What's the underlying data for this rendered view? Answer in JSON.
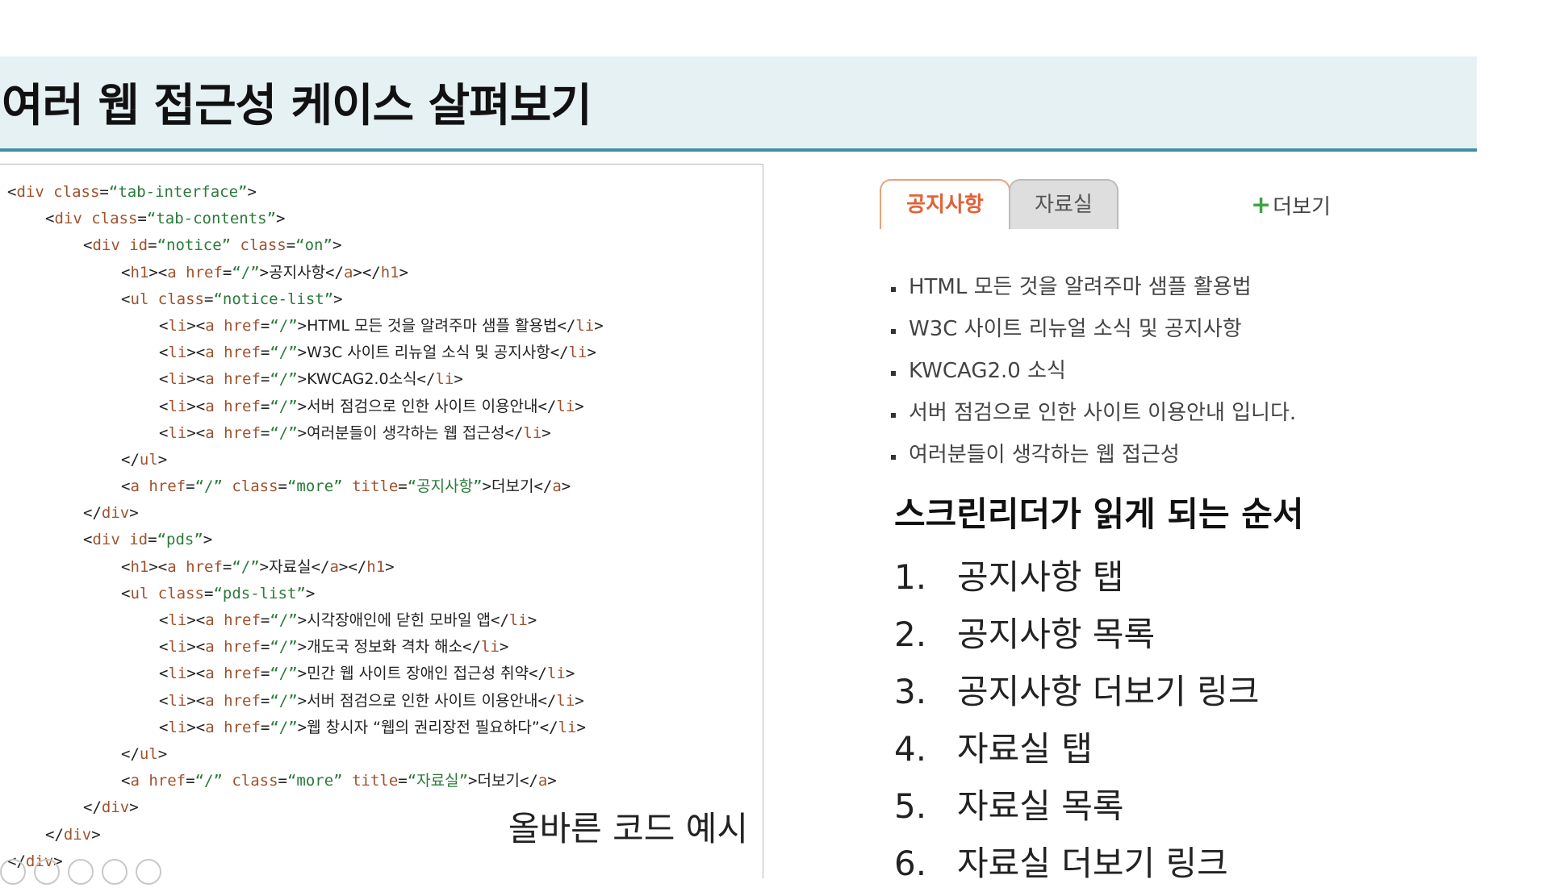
{
  "slide": {
    "title": "여러 웹 접근성 케이스 살펴보기",
    "caption": "올바른 코드 예시"
  },
  "code_lines": [
    {
      "indent": 0,
      "parts": [
        [
          "p",
          "<"
        ],
        [
          "t",
          "div"
        ],
        [
          "a",
          " class"
        ],
        [
          "p",
          "="
        ],
        [
          "v",
          "“tab-interface”"
        ],
        [
          "p",
          ">"
        ]
      ]
    },
    {
      "indent": 1,
      "parts": [
        [
          "p",
          "<"
        ],
        [
          "t",
          "div"
        ],
        [
          "a",
          " class"
        ],
        [
          "p",
          "="
        ],
        [
          "v",
          "“tab-contents”"
        ],
        [
          "p",
          ">"
        ]
      ]
    },
    {
      "indent": 2,
      "parts": [
        [
          "p",
          "<"
        ],
        [
          "t",
          "div"
        ],
        [
          "a",
          " id"
        ],
        [
          "p",
          "="
        ],
        [
          "v",
          "“notice”"
        ],
        [
          "a",
          " class"
        ],
        [
          "p",
          "="
        ],
        [
          "v",
          "“on”"
        ],
        [
          "p",
          ">"
        ]
      ]
    },
    {
      "indent": 3,
      "parts": [
        [
          "p",
          "<"
        ],
        [
          "t",
          "h1"
        ],
        [
          "p",
          "><"
        ],
        [
          "t",
          "a"
        ],
        [
          "a",
          " href"
        ],
        [
          "p",
          "="
        ],
        [
          "v",
          "“/”"
        ],
        [
          "p",
          ">"
        ],
        [
          "x",
          "공지사항"
        ],
        [
          "p",
          "</"
        ],
        [
          "t",
          "a"
        ],
        [
          "p",
          "></"
        ],
        [
          "t",
          "h1"
        ],
        [
          "p",
          ">"
        ]
      ]
    },
    {
      "indent": 3,
      "parts": [
        [
          "p",
          "<"
        ],
        [
          "t",
          "ul"
        ],
        [
          "a",
          " class"
        ],
        [
          "p",
          "="
        ],
        [
          "v",
          "“notice-list”"
        ],
        [
          "p",
          ">"
        ]
      ]
    },
    {
      "indent": 4,
      "parts": [
        [
          "p",
          "<"
        ],
        [
          "t",
          "li"
        ],
        [
          "p",
          "><"
        ],
        [
          "t",
          "a"
        ],
        [
          "a",
          " href"
        ],
        [
          "p",
          "="
        ],
        [
          "v",
          "“/”"
        ],
        [
          "p",
          ">"
        ],
        [
          "x",
          "HTML 모든 것을 알려주마 샘플 활용법"
        ],
        [
          "p",
          "</"
        ],
        [
          "t",
          "li"
        ],
        [
          "p",
          ">"
        ]
      ]
    },
    {
      "indent": 4,
      "parts": [
        [
          "p",
          "<"
        ],
        [
          "t",
          "li"
        ],
        [
          "p",
          "><"
        ],
        [
          "t",
          "a"
        ],
        [
          "a",
          " href"
        ],
        [
          "p",
          "="
        ],
        [
          "v",
          "“/”"
        ],
        [
          "p",
          ">"
        ],
        [
          "x",
          "W3C 사이트 리뉴얼 소식 및 공지사항"
        ],
        [
          "p",
          "</"
        ],
        [
          "t",
          "li"
        ],
        [
          "p",
          ">"
        ]
      ]
    },
    {
      "indent": 4,
      "parts": [
        [
          "p",
          "<"
        ],
        [
          "t",
          "li"
        ],
        [
          "p",
          "><"
        ],
        [
          "t",
          "a"
        ],
        [
          "a",
          " href"
        ],
        [
          "p",
          "="
        ],
        [
          "v",
          "“/”"
        ],
        [
          "p",
          ">"
        ],
        [
          "x",
          "KWCAG2.0소식"
        ],
        [
          "p",
          "</"
        ],
        [
          "t",
          "li"
        ],
        [
          "p",
          ">"
        ]
      ]
    },
    {
      "indent": 4,
      "parts": [
        [
          "p",
          "<"
        ],
        [
          "t",
          "li"
        ],
        [
          "p",
          "><"
        ],
        [
          "t",
          "a"
        ],
        [
          "a",
          " href"
        ],
        [
          "p",
          "="
        ],
        [
          "v",
          "“/”"
        ],
        [
          "p",
          ">"
        ],
        [
          "x",
          "서버 점검으로 인한 사이트 이용안내"
        ],
        [
          "p",
          "</"
        ],
        [
          "t",
          "li"
        ],
        [
          "p",
          ">"
        ]
      ]
    },
    {
      "indent": 4,
      "parts": [
        [
          "p",
          "<"
        ],
        [
          "t",
          "li"
        ],
        [
          "p",
          "><"
        ],
        [
          "t",
          "a"
        ],
        [
          "a",
          " href"
        ],
        [
          "p",
          "="
        ],
        [
          "v",
          "“/”"
        ],
        [
          "p",
          ">"
        ],
        [
          "x",
          "여러분들이 생각하는 웹 접근성"
        ],
        [
          "p",
          "</"
        ],
        [
          "t",
          "li"
        ],
        [
          "p",
          ">"
        ]
      ]
    },
    {
      "indent": 3,
      "parts": [
        [
          "p",
          "</"
        ],
        [
          "t",
          "ul"
        ],
        [
          "p",
          ">"
        ]
      ]
    },
    {
      "indent": 3,
      "parts": [
        [
          "p",
          "<"
        ],
        [
          "t",
          "a"
        ],
        [
          "a",
          " href"
        ],
        [
          "p",
          "="
        ],
        [
          "v",
          "“/”"
        ],
        [
          "a",
          " class"
        ],
        [
          "p",
          "="
        ],
        [
          "v",
          "“more”"
        ],
        [
          "a",
          " title"
        ],
        [
          "p",
          "="
        ],
        [
          "v",
          "“공지사항”"
        ],
        [
          "p",
          ">"
        ],
        [
          "x",
          "더보기"
        ],
        [
          "p",
          "</"
        ],
        [
          "t",
          "a"
        ],
        [
          "p",
          ">"
        ]
      ]
    },
    {
      "indent": 2,
      "parts": [
        [
          "p",
          "</"
        ],
        [
          "t",
          "div"
        ],
        [
          "p",
          ">"
        ]
      ]
    },
    {
      "indent": 2,
      "parts": [
        [
          "p",
          "<"
        ],
        [
          "t",
          "div"
        ],
        [
          "a",
          " id"
        ],
        [
          "p",
          "="
        ],
        [
          "v",
          "“pds”"
        ],
        [
          "p",
          ">"
        ]
      ]
    },
    {
      "indent": 3,
      "parts": [
        [
          "p",
          "<"
        ],
        [
          "t",
          "h1"
        ],
        [
          "p",
          "><"
        ],
        [
          "t",
          "a"
        ],
        [
          "a",
          " href"
        ],
        [
          "p",
          "="
        ],
        [
          "v",
          "“/”"
        ],
        [
          "p",
          ">"
        ],
        [
          "x",
          "자료실"
        ],
        [
          "p",
          "</"
        ],
        [
          "t",
          "a"
        ],
        [
          "p",
          "></"
        ],
        [
          "t",
          "h1"
        ],
        [
          "p",
          ">"
        ]
      ]
    },
    {
      "indent": 3,
      "parts": [
        [
          "p",
          "<"
        ],
        [
          "t",
          "ul"
        ],
        [
          "a",
          " class"
        ],
        [
          "p",
          "="
        ],
        [
          "v",
          "“pds-list”"
        ],
        [
          "p",
          ">"
        ]
      ]
    },
    {
      "indent": 4,
      "parts": [
        [
          "p",
          "<"
        ],
        [
          "t",
          "li"
        ],
        [
          "p",
          "><"
        ],
        [
          "t",
          "a"
        ],
        [
          "a",
          " href"
        ],
        [
          "p",
          "="
        ],
        [
          "v",
          "“/”"
        ],
        [
          "p",
          ">"
        ],
        [
          "x",
          "시각장애인에 닫힌 모바일 앱"
        ],
        [
          "p",
          "</"
        ],
        [
          "t",
          "li"
        ],
        [
          "p",
          ">"
        ]
      ]
    },
    {
      "indent": 4,
      "parts": [
        [
          "p",
          "<"
        ],
        [
          "t",
          "li"
        ],
        [
          "p",
          "><"
        ],
        [
          "t",
          "a"
        ],
        [
          "a",
          " href"
        ],
        [
          "p",
          "="
        ],
        [
          "v",
          "“/”"
        ],
        [
          "p",
          ">"
        ],
        [
          "x",
          "개도국 정보화 격차 해소"
        ],
        [
          "p",
          "</"
        ],
        [
          "t",
          "li"
        ],
        [
          "p",
          ">"
        ]
      ]
    },
    {
      "indent": 4,
      "parts": [
        [
          "p",
          "<"
        ],
        [
          "t",
          "li"
        ],
        [
          "p",
          "><"
        ],
        [
          "t",
          "a"
        ],
        [
          "a",
          " href"
        ],
        [
          "p",
          "="
        ],
        [
          "v",
          "“/”"
        ],
        [
          "p",
          ">"
        ],
        [
          "x",
          "민간 웹 사이트 장애인 접근성 취약"
        ],
        [
          "p",
          "</"
        ],
        [
          "t",
          "li"
        ],
        [
          "p",
          ">"
        ]
      ]
    },
    {
      "indent": 4,
      "parts": [
        [
          "p",
          "<"
        ],
        [
          "t",
          "li"
        ],
        [
          "p",
          "><"
        ],
        [
          "t",
          "a"
        ],
        [
          "a",
          " href"
        ],
        [
          "p",
          "="
        ],
        [
          "v",
          "“/”"
        ],
        [
          "p",
          ">"
        ],
        [
          "x",
          "서버 점검으로 인한 사이트 이용안내"
        ],
        [
          "p",
          "</"
        ],
        [
          "t",
          "li"
        ],
        [
          "p",
          ">"
        ]
      ]
    },
    {
      "indent": 4,
      "parts": [
        [
          "p",
          "<"
        ],
        [
          "t",
          "li"
        ],
        [
          "p",
          "><"
        ],
        [
          "t",
          "a"
        ],
        [
          "a",
          " href"
        ],
        [
          "p",
          "="
        ],
        [
          "v",
          "“/”"
        ],
        [
          "p",
          ">"
        ],
        [
          "x",
          "웹 창시자 “웹의 권리장전 필요하다”"
        ],
        [
          "p",
          "</"
        ],
        [
          "t",
          "li"
        ],
        [
          "p",
          ">"
        ]
      ]
    },
    {
      "indent": 3,
      "parts": [
        [
          "p",
          "</"
        ],
        [
          "t",
          "ul"
        ],
        [
          "p",
          ">"
        ]
      ]
    },
    {
      "indent": 3,
      "parts": [
        [
          "p",
          "<"
        ],
        [
          "t",
          "a"
        ],
        [
          "a",
          " href"
        ],
        [
          "p",
          "="
        ],
        [
          "v",
          "“/”"
        ],
        [
          "a",
          " class"
        ],
        [
          "p",
          "="
        ],
        [
          "v",
          "“more”"
        ],
        [
          "a",
          " title"
        ],
        [
          "p",
          "="
        ],
        [
          "v",
          "“자료실”"
        ],
        [
          "p",
          ">"
        ],
        [
          "x",
          "더보기"
        ],
        [
          "p",
          "</"
        ],
        [
          "t",
          "a"
        ],
        [
          "p",
          ">"
        ]
      ]
    },
    {
      "indent": 2,
      "parts": [
        [
          "p",
          "</"
        ],
        [
          "t",
          "div"
        ],
        [
          "p",
          ">"
        ]
      ]
    },
    {
      "indent": 1,
      "parts": [
        [
          "p",
          "</"
        ],
        [
          "t",
          "div"
        ],
        [
          "p",
          ">"
        ]
      ]
    },
    {
      "indent": 0,
      "parts": [
        [
          "p",
          "</"
        ],
        [
          "t",
          "div"
        ],
        [
          "p",
          ">"
        ]
      ]
    }
  ],
  "tab_widget": {
    "tabs": [
      "공지사항",
      "자료실"
    ],
    "more_label": "더보기",
    "more_icon": "plus-icon",
    "notice_items": [
      "HTML 모든 것을 알려주마 샘플 활용법",
      "W3C 사이트 리뉴얼 소식 및 공지사항",
      "KWCAG2.0 소식",
      "서버 점검으로 인한 사이트 이용안내 입니다.",
      "여러분들이 생각하는 웹 접근성"
    ]
  },
  "reading_order": {
    "title": "스크린리더가 읽게 되는 순서",
    "items": [
      {
        "num": "1.",
        "text": "공지사항 탭"
      },
      {
        "num": "2.",
        "text": "공지사항 목록"
      },
      {
        "num": "3.",
        "text": "공지사항 더보기 링크"
      },
      {
        "num": "4.",
        "text": "자료실 탭"
      },
      {
        "num": "5.",
        "text": "자료실 목록"
      },
      {
        "num": "6.",
        "text": "자료실 더보기 링크"
      }
    ]
  },
  "colors": {
    "title_bg": "#e6f1f4",
    "title_rule": "#3e8fa6",
    "active_tab_text": "#e0623a",
    "code_tag": "#a0522d",
    "code_value": "#2a7a3a",
    "plus_icon": "#3fa344"
  }
}
